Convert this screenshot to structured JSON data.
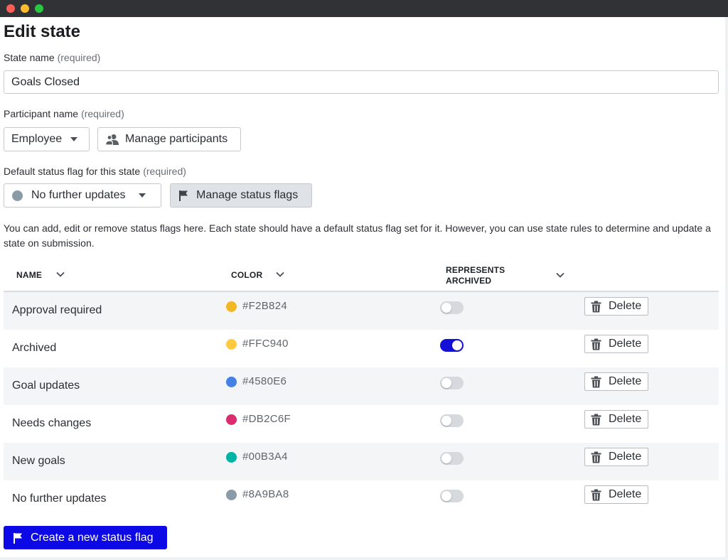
{
  "page": {
    "title": "Edit state"
  },
  "state_name": {
    "label": "State name",
    "required": "(required)",
    "value": "Goals Closed"
  },
  "participant": {
    "label": "Participant name",
    "required": "(required)",
    "selected": "Employee",
    "manage_label": "Manage participants"
  },
  "status_flag": {
    "label": "Default status flag for this state",
    "required": "(required)",
    "selected": "No further updates",
    "selected_color": "#8A9BA8",
    "manage_label": "Manage status flags"
  },
  "help_text": "You can add, edit or remove status flags here. Each state should have a default status flag set for it. However, you can use state rules to determine and update a state on submission.",
  "table": {
    "columns": {
      "name": "NAME",
      "color": "COLOR",
      "archived_line1": "REPRESENTS",
      "archived_line2": "ARCHIVED"
    },
    "delete_label": "Delete",
    "rows": [
      {
        "name": "Approval required",
        "color": "#F2B824",
        "archived": false
      },
      {
        "name": "Archived",
        "color": "#FFC940",
        "archived": true
      },
      {
        "name": "Goal updates",
        "color": "#4580E6",
        "archived": false
      },
      {
        "name": "Needs changes",
        "color": "#DB2C6F",
        "archived": false
      },
      {
        "name": "New goals",
        "color": "#00B3A4",
        "archived": false
      },
      {
        "name": "No further updates",
        "color": "#8A9BA8",
        "archived": false
      }
    ]
  },
  "create_button": {
    "label": "Create a new status flag"
  },
  "icons": {
    "people": "people-icon",
    "flag": "flag-icon",
    "trash": "trash-icon",
    "chevron": "chevron-down-icon",
    "caret": "caret-down-icon"
  }
}
